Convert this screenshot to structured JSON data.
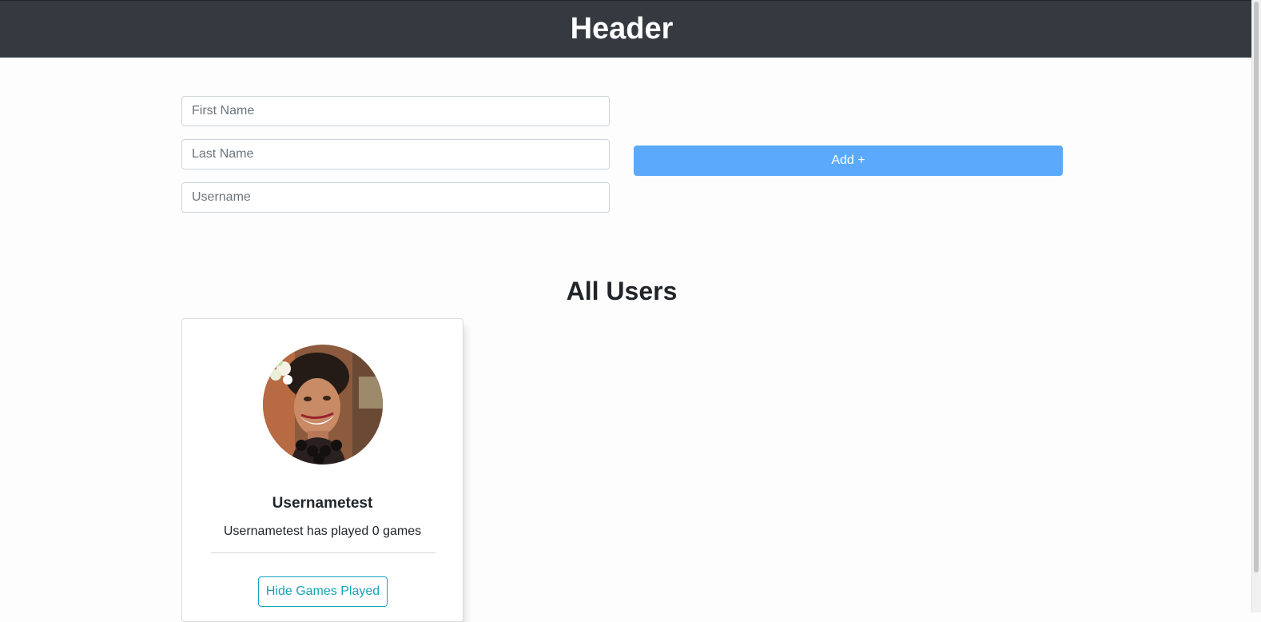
{
  "header": {
    "title": "Header"
  },
  "form": {
    "first_name_placeholder": "First Name",
    "last_name_placeholder": "Last Name",
    "username_placeholder": "Username",
    "add_label": "Add +"
  },
  "users_section": {
    "title": "All Users"
  },
  "users": [
    {
      "username": "Usernametest",
      "games_text": "Usernametest has played 0 games",
      "toggle_label": "Hide Games Played"
    }
  ],
  "colors": {
    "header_bg": "#343a40",
    "add_button": "#5aa9fc",
    "info_outline": "#17a2b8"
  }
}
